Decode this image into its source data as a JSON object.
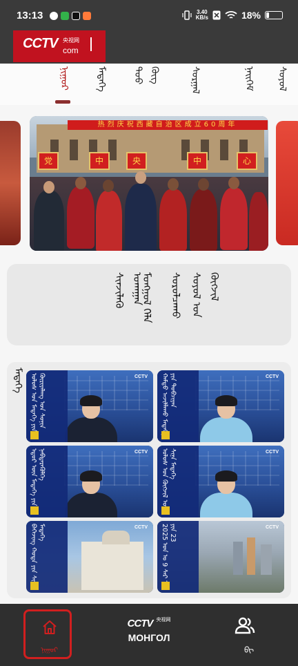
{
  "status_bar": {
    "time": "13:13",
    "net_speed_value": "3.40",
    "net_speed_unit": "KB/s",
    "battery_percent": "18%",
    "battery_level": 0.18
  },
  "header": {
    "logo_text": "CCTV",
    "logo_domain": "com",
    "logo_chinese": "央视网"
  },
  "categories": [
    {
      "label": "ᠨᠢᠭᠤᠷ",
      "active": true
    },
    {
      "label": "ᠮᠡᠳᠡᠭᠡ",
      "active": false
    },
    {
      "label": "ᠳᠤᠤ ᠬᠦᠭ",
      "active": false
    },
    {
      "label": "ᠰᠤᠷᠭᠠᠯ",
      "active": false
    },
    {
      "label": "ᠨᠡᠢᠭᠡᠮ",
      "active": false
    },
    {
      "label": "ᠰᠤᠶᠤᠯ",
      "active": false
    }
  ],
  "carousel": {
    "banner_text": "热烈庆祝西藏自治区成立60周年",
    "plaque_text": [
      "党",
      "中",
      "央",
      "中",
      "心"
    ]
  },
  "featured_text": [
    "ᠰᠢᠨᠵᠢᠯᠡᠬᠦ ᠤᠬᠠᠭᠠᠨ",
    "ᠮᠣᠩᠭᠣᠯ ᠬᠡᠯᠡ",
    "ᠰᠤᠷᠤᠯᠴᠠᠬᠤ",
    "ᠰᠣᠶᠣᠯ ᠤᠨ ᠬᠥᠭᠵᠢᠯ"
  ],
  "news_section": {
    "title": "ᠮᠡᠳᠡᠭᠡ",
    "items": [
      {
        "caption": "ᠤᠯᠤᠰ ᠤᠨ ᠮᠡᠳᠡᠭᠡ ᠶᠢᠨ ᠬᠦᠷᠢᠶᠡᠯᠡᠩ ᠤᠨ ᠰᠣᠨᠢᠨ",
        "bug": "CCTV"
      },
      {
        "caption": "ᠬᠠᠮᠲᠤ ᠠᠵᠢᠯᠯᠠᠬᠤ ᠮᠡᠳᠡᠭᠡ ᠶᠢᠨ ᠲᠣᠪᠴᠢᠶᠠᠨ",
        "bug": "CCTV"
      },
      {
        "caption": "ᠡᠳᠦᠷ ᠦᠨ ᠮᠡᠳᠡᠭᠡ ᠶᠢᠨ ᠨᠡᠪᠲᠡᠷᠡᠭᠦᠯᠭᠡ",
        "bug": "CCTV"
      },
      {
        "caption": "ᠤᠯᠤᠰ ᠤᠨ ᠬᠥᠭᠵᠢᠯ ᠦᠨ ᠰᠢᠨᠡ ᠮᠡᠳᠡᠭᠡ",
        "bug": "CCTV"
      },
      {
        "caption": "ᠪᠡᠭᠡᠵᠢᠩ ᠬᠣᠲᠠ ᠶᠢᠨ ᠰᠢᠨᠡ ᠮᠡᠳᠡᠭᠡ",
        "bug": "CCTV"
      },
      {
        "caption": "2025 ᠣᠨ ᠤ 9 ᠰᠠᠷ ᠠ ᠶᠢᠨ 23",
        "bug": "CCTV"
      }
    ]
  },
  "bottom_nav": {
    "home_label": "ᠨᠢᠭᠤᠷ",
    "center_logo": "CCTV",
    "center_logo_cn": "央视网",
    "center_label": "МОНГОЛ",
    "user_label": "ᠪᠢ"
  },
  "colors": {
    "brand_red": "#c1121f",
    "dark_bar": "#3a3a3a",
    "nav_bg": "#2f2f2f",
    "accent_active": "#b11a1a"
  },
  "icons": [
    "signal-icon",
    "wifi-icon",
    "battery-icon",
    "home-icon",
    "user-group-icon"
  ]
}
